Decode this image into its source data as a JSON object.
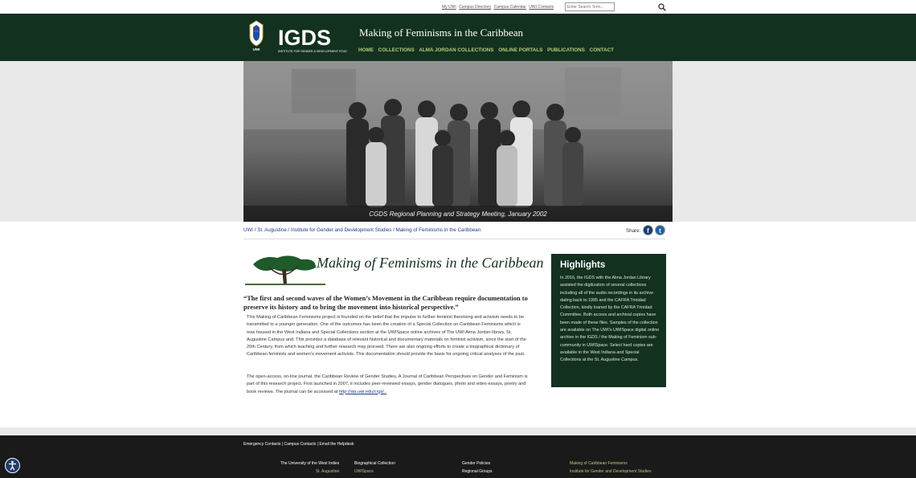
{
  "topbar": {
    "links": [
      "My UWI",
      "Campus Directory",
      "Campus Calendar",
      "UWI Contacts"
    ],
    "search_placeholder": "Enter Search Term..."
  },
  "header": {
    "logo_text": "INSTITUTE FOR GENDER & DEVELOPMENT STUDIES",
    "crest_text": "UWI ST. AUGUSTINE CAMPUS",
    "title": "Making of Feminisms in the Caribbean",
    "nav": [
      "HOME",
      "COLLECTIONS",
      "ALMA JORDAN COLLECTIONS",
      "ONLINE PORTALS",
      "PUBLICATIONS",
      "CONTACT"
    ]
  },
  "hero": {
    "caption": "CGDS Regional Planning and Strategy Meeting, January 2002"
  },
  "breadcrumb": {
    "items": [
      "UWI",
      "St. Augustine",
      "Institute for Gender and Development Studies",
      "Making of Feminisms in the Caribbean"
    ],
    "separator": " / "
  },
  "share": {
    "label": "Share:",
    "facebook": "f",
    "twitter": "t"
  },
  "banner": {
    "text": "Making of Feminisms in the Caribbean"
  },
  "article": {
    "quote": "“The first and second waves of the Women’s Movement in the Caribbean require documentation to preserve its history and to bring the movement into historical perspective.”",
    "p1": "This Making of Caribbean Feminisms project is founded on the belief that the impulse to further feminist theorising and activism needs to be transmitted to a younger generation. One of the outcomes has been the creation of a Special Collection on Caribbean Feminisms which is now housed in the West Indiana and Special Collections section at the UWISpace online archives of The UWI Alma Jordan library, St. Augustine Campus and. This provides a database of relevant historical and documentary materials on feminist activism, since the start of the 20th Century, from which teaching and further research may proceed. There are also ongoing efforts to create a biographical dictionary of Caribbean feminists and women’s movement activists. This documentation should provide the basis for ongoing critical analyses of the past.",
    "p2": "The open-access, on-line journal, the Caribbean Review of Gender Studies, A Journal of Caribbean Perspectives on Gender and Feminism is part of this research project. First launched in 2007, it includes peer-reviewed essays, gender dialogues, photo and video essays, poetry and book reviews. The journal can be accessed at",
    "p2_link": "http://sta.uwi.edu/crgs/ ."
  },
  "highlights": {
    "title": "Highlights",
    "text": "In 2016, the IGDS with the Alma Jordan Library assisted the digitization of several collections including all of the audio recordings in its archive dating back to 1995 and the CAFRA Trinidad Collection, kindly loaned by the CAFRA Trinidad Committee. Both access and archival copies have been made of these files. Samples of the collection are available on The UWI’s UWISpace digital online archive in the IGDS / the Making of Feminism sub-community in UWISpace. Select hard copies are available in the West Indiana and Special Collections at the St. Augustine Campus."
  },
  "footer": {
    "links": [
      "Emergency Contacts",
      "Campus Contacts",
      "Email the Helpdesk"
    ],
    "col1": [
      "The University of the West Indies",
      "St. Augustine"
    ],
    "col2": [
      "Biographical Collection",
      "UWISpace"
    ],
    "col3": [
      "Gender Policies",
      "Regional Groups"
    ],
    "col4": [
      "Making of Caribbean Feminisms",
      "Institute for Gender and Development Studies"
    ]
  },
  "accessibility": {
    "icon": "accessibility-icon"
  },
  "colors": {
    "header_green": "#13311f",
    "nav_green": "#b4cc7a",
    "link_blue": "#1a3a8a",
    "footer_dark": "#1a1a1a"
  }
}
